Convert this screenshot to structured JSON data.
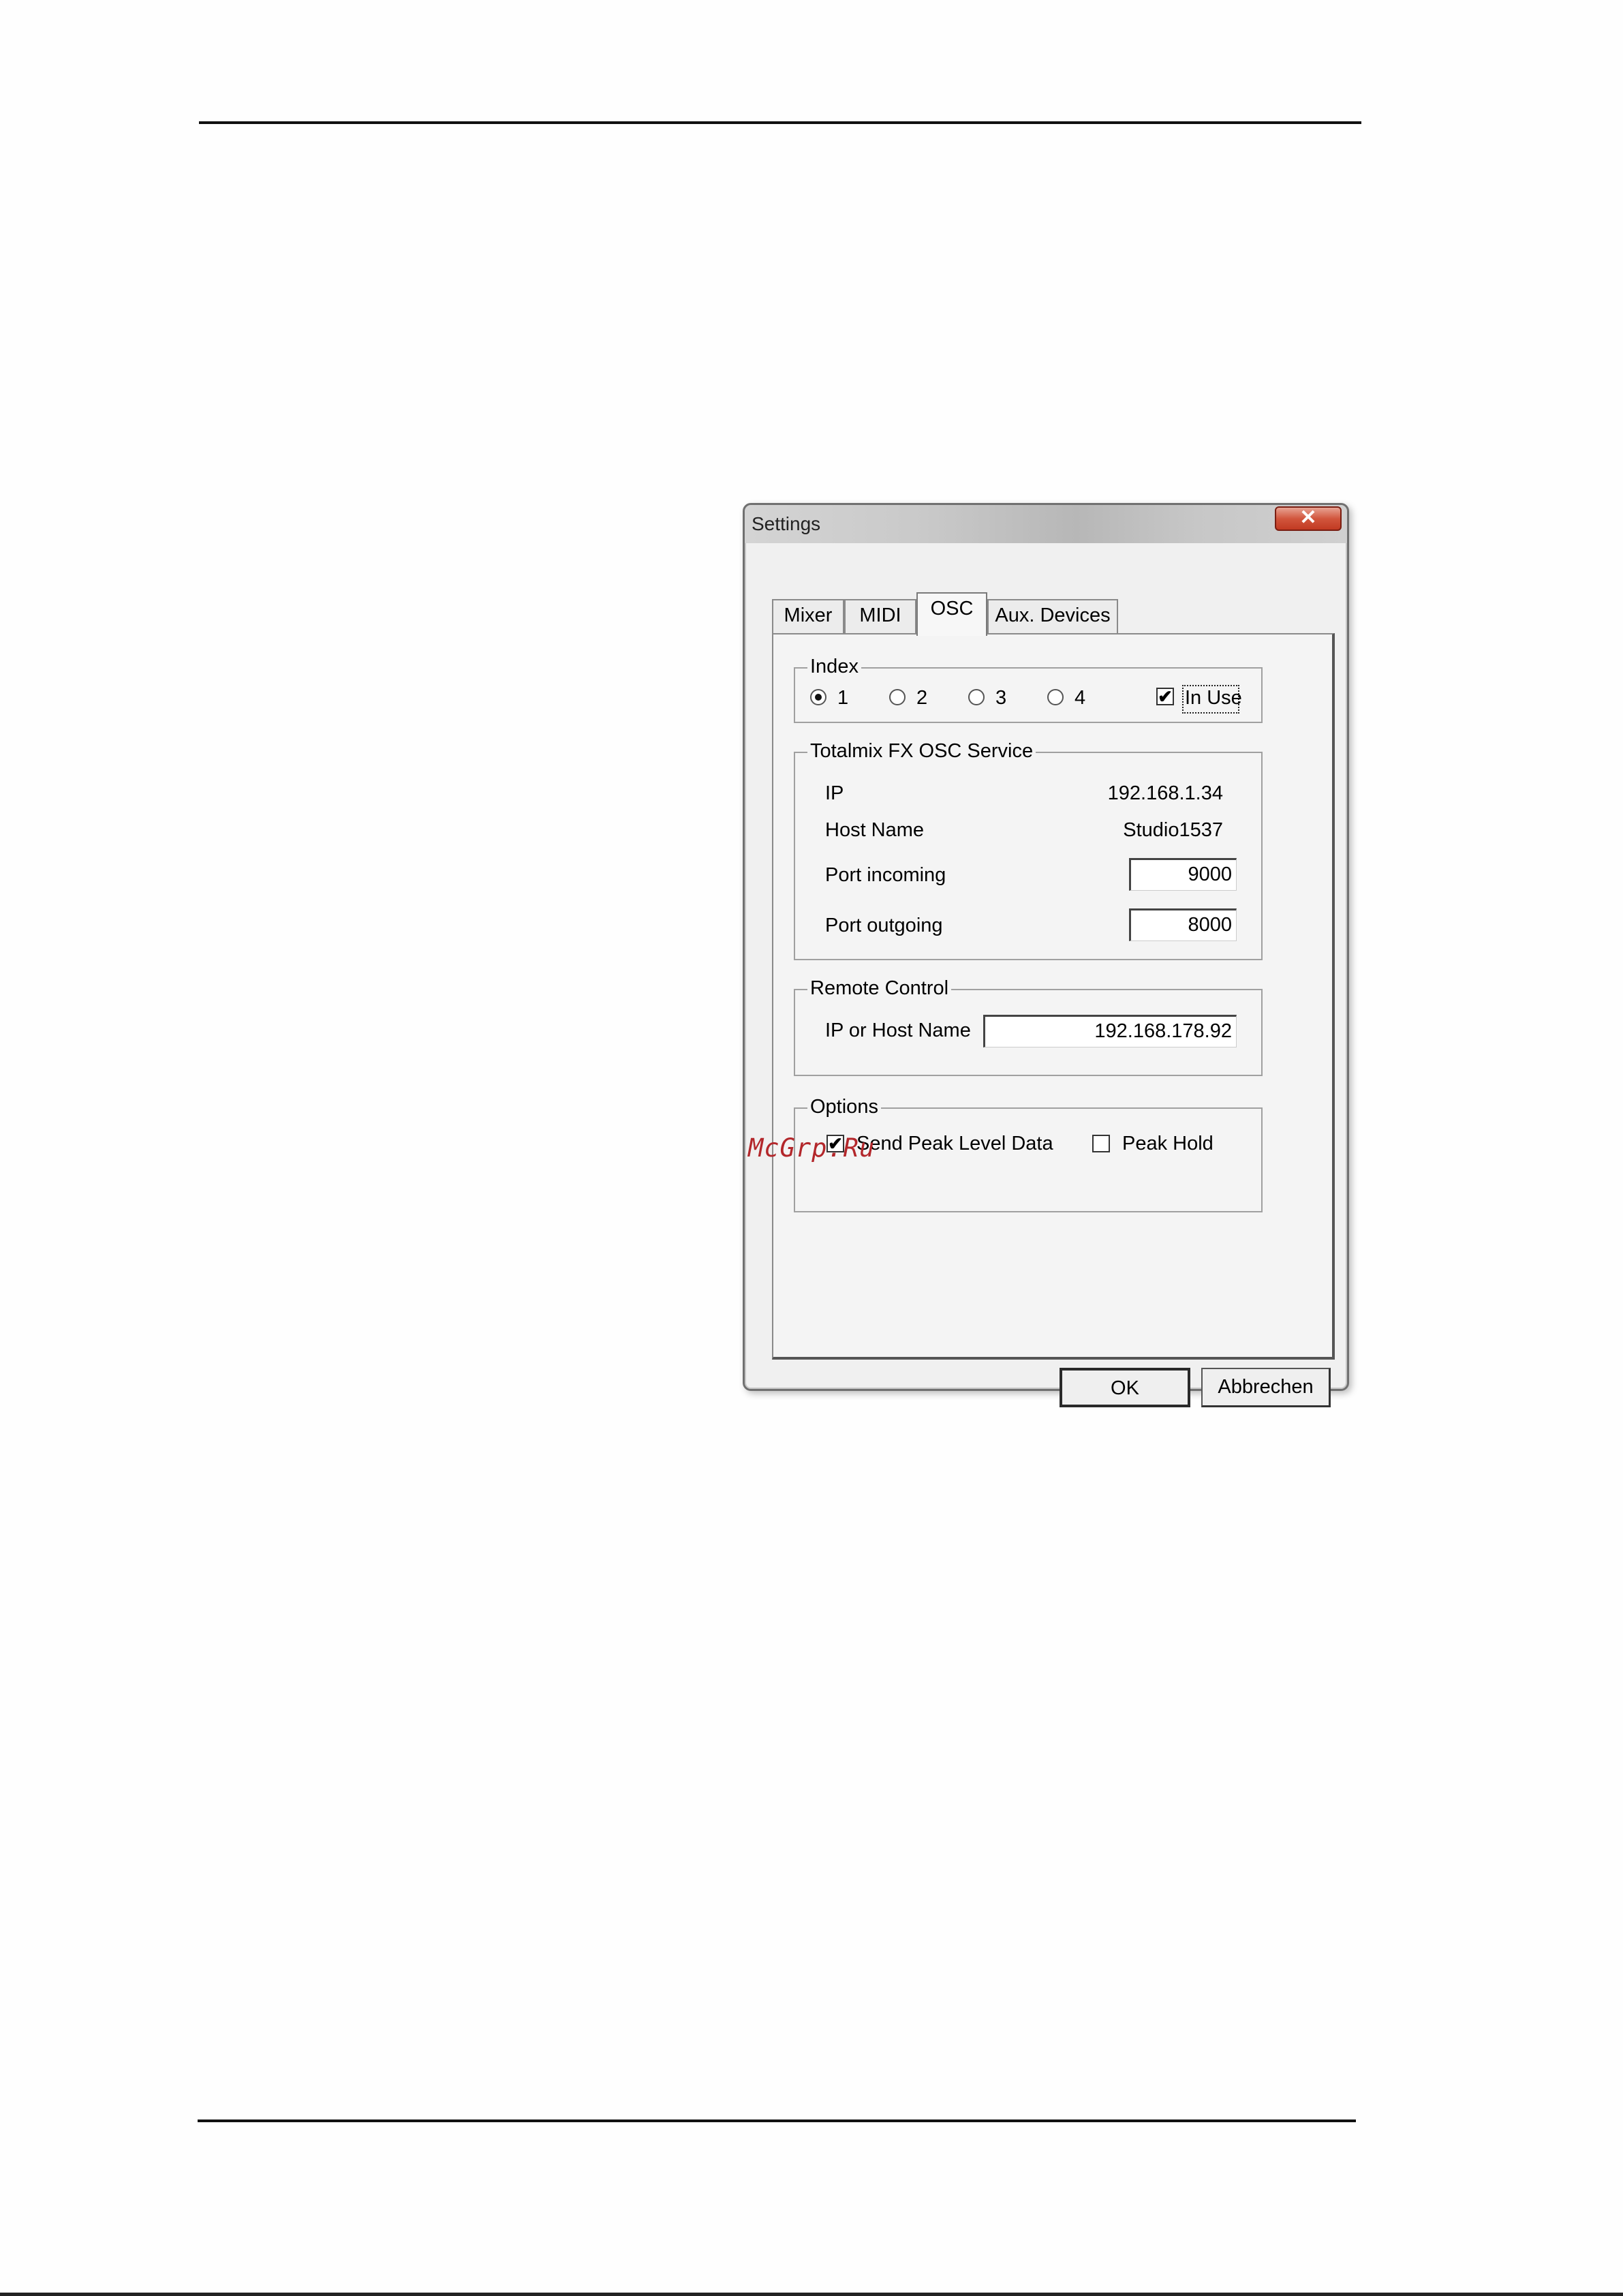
{
  "window": {
    "title": "Settings",
    "close_glyph": "✕"
  },
  "tabs": [
    {
      "label": "Mixer"
    },
    {
      "label": "MIDI"
    },
    {
      "label": "OSC",
      "active": true
    },
    {
      "label": "Aux. Devices"
    }
  ],
  "index": {
    "legend": "Index",
    "options": [
      "1",
      "2",
      "3",
      "4"
    ],
    "selected": "1",
    "in_use_label": "In Use",
    "in_use_checked": true
  },
  "osc_service": {
    "legend": "Totalmix FX OSC Service",
    "ip_label": "IP",
    "ip_value": "192.168.1.34",
    "host_label": "Host Name",
    "host_value": "Studio1537",
    "port_in_label": "Port incoming",
    "port_in_value": "9000",
    "port_out_label": "Port outgoing",
    "port_out_value": "8000"
  },
  "remote_control": {
    "legend": "Remote Control",
    "host_label": "IP or Host Name",
    "host_value": "192.168.178.92"
  },
  "options": {
    "legend": "Options",
    "send_peak_label": "Send Peak Level Data",
    "send_peak_checked": true,
    "peak_hold_label": "Peak Hold",
    "peak_hold_checked": false
  },
  "buttons": {
    "ok": "OK",
    "cancel": "Abbrechen"
  },
  "watermark": "McGrp.Ru",
  "icons": {
    "check": "✔"
  }
}
